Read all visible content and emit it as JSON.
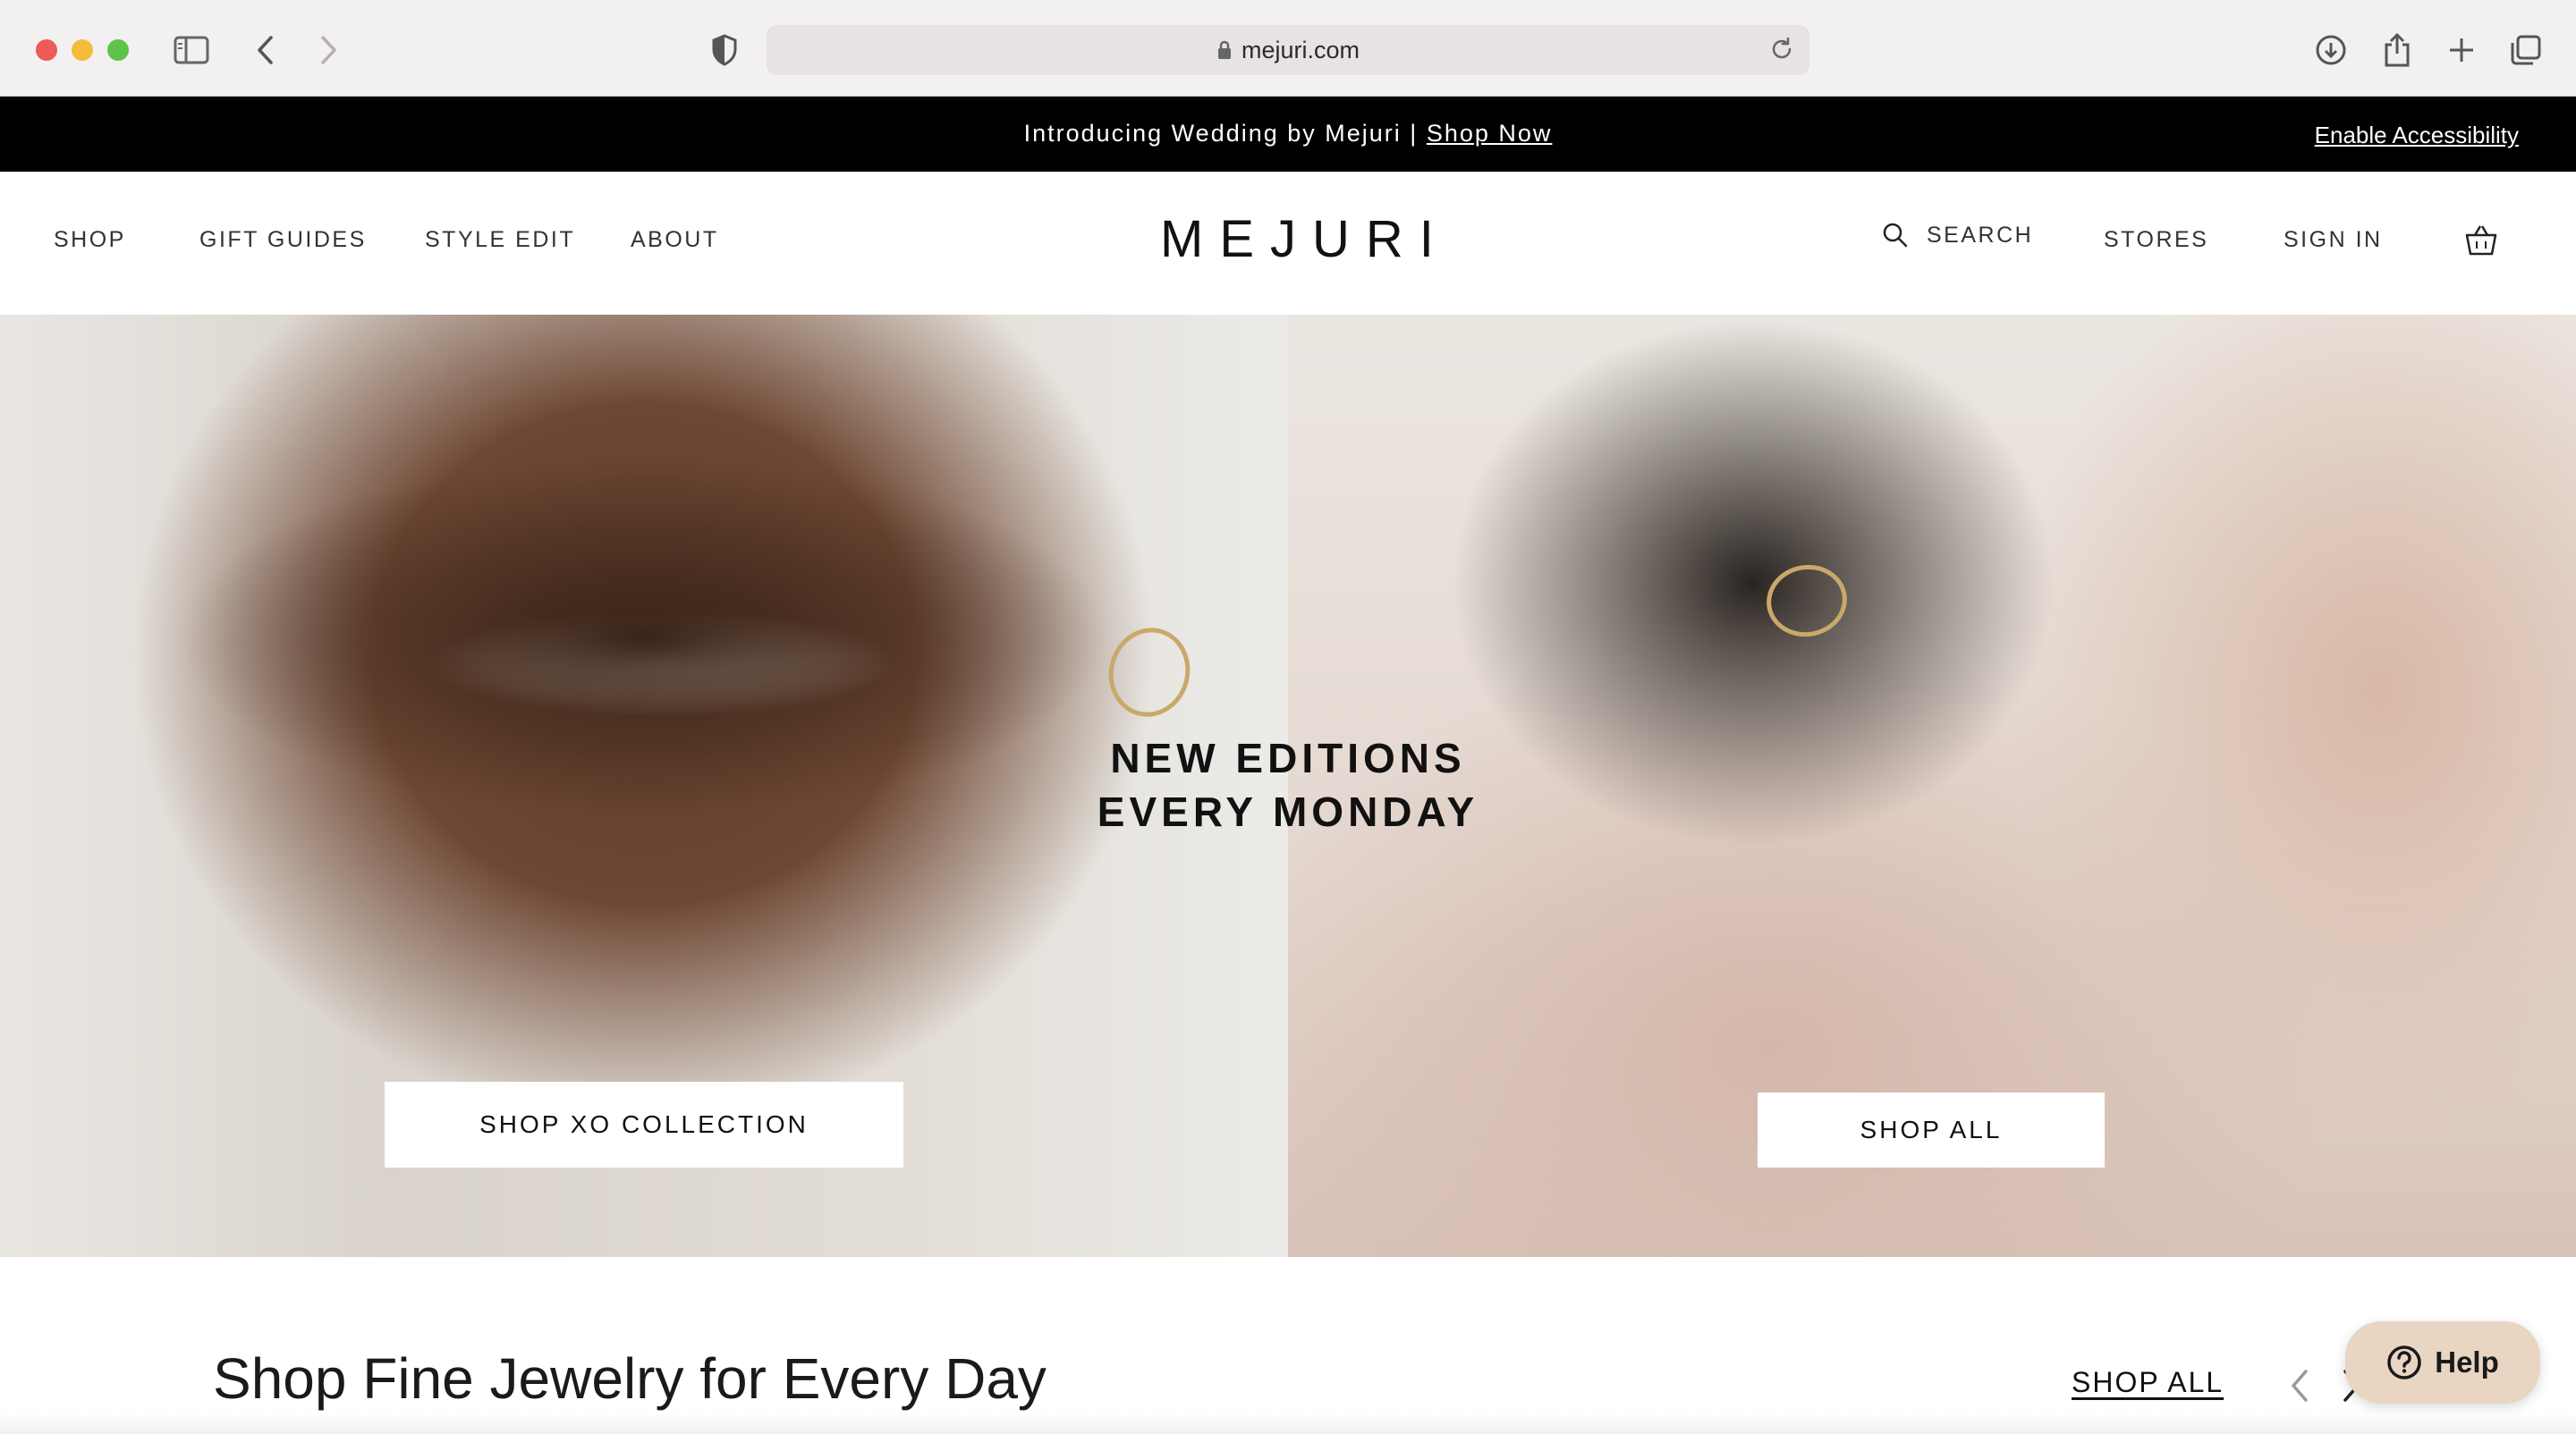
{
  "browser": {
    "url": "mejuri.com"
  },
  "announcement": {
    "text": "Introducing Wedding by Mejuri |",
    "link": "Shop Now",
    "accessibility": "Enable Accessibility"
  },
  "nav": {
    "left": [
      "SHOP",
      "GIFT GUIDES",
      "STYLE EDIT",
      "ABOUT"
    ],
    "logo": "MEJURI",
    "search": "SEARCH",
    "stores": "STORES",
    "sign_in": "SIGN IN"
  },
  "hero": {
    "headline_line1": "NEW EDITIONS",
    "headline_line2": "EVERY MONDAY",
    "left_button": "SHOP XO COLLECTION",
    "right_button": "SHOP ALL"
  },
  "section": {
    "title": "Shop Fine Jewelry for Every Day",
    "shop_all": "SHOP ALL"
  },
  "help": {
    "label": "Help"
  },
  "colors": {
    "announcement_bg": "#000000",
    "help_bg": "#e8d6c3",
    "chrome_bg": "#f3f0f2"
  }
}
